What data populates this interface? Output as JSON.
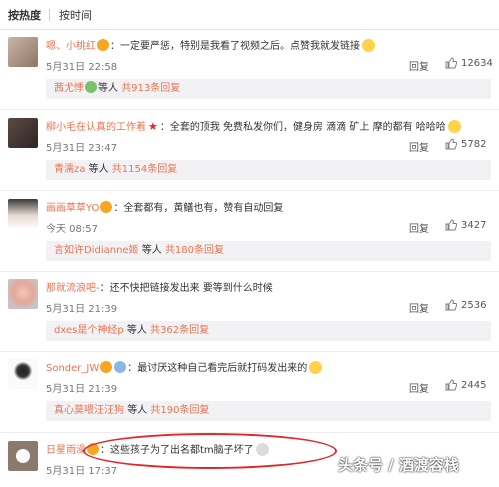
{
  "sort": {
    "hot": "按热度",
    "time": "按时间"
  },
  "reply_label": "回复",
  "colors": {
    "username": "#eb7350",
    "accent_red": "#e0282c"
  },
  "comments": [
    {
      "user": "嗯、小桃红",
      "text": "：一定要严惩，特别是我看了视频之后。点赞我就发链接",
      "time": "5月31日 22:58",
      "likes": "12634",
      "sub": {
        "name": "茜尤悸",
        "mid": "等人",
        "count": "共913条回复"
      }
    },
    {
      "user": "柳小毛在认真的工作着",
      "text": "：全套的顶我 免费私发你们，健身房 滴滴 矿上 摩的都有 哈哈哈",
      "time": "5月31日 23:47",
      "likes": "5782",
      "sub": {
        "name": "青濡za",
        "mid": "等人",
        "count": "共1154条回复"
      }
    },
    {
      "user": "画画草草YO",
      "text": "：全套都有，黄鳝也有，赞有自动回复",
      "time": "今天 08:57",
      "likes": "3427",
      "sub": {
        "name": "言如许Didianne姬",
        "mid": "等人",
        "count": "共180条回复"
      }
    },
    {
      "user": "那就流浪吧-",
      "text": "：还不快把链接发出来 要等到什么时候",
      "time": "5月31日 21:39",
      "likes": "2536",
      "sub": {
        "name": "dxes是个神经p",
        "mid": "等人",
        "count": "共362条回复"
      }
    },
    {
      "user": "Sonder_JW",
      "text": "：最讨厌这种自己看完后就打码发出来的",
      "time": "5月31日 21:39",
      "likes": "2445",
      "sub": {
        "name": "真心莫喂汪汪狗",
        "mid": "等人",
        "count": "共190条回复"
      }
    },
    {
      "user": "日星雨澡",
      "text": "：这些孩子为了出名都tm脑子坏了",
      "time": "5月31日 17:37",
      "likes": "",
      "sub": null
    }
  ],
  "watermark": "头条号 / 酒渡容栈"
}
